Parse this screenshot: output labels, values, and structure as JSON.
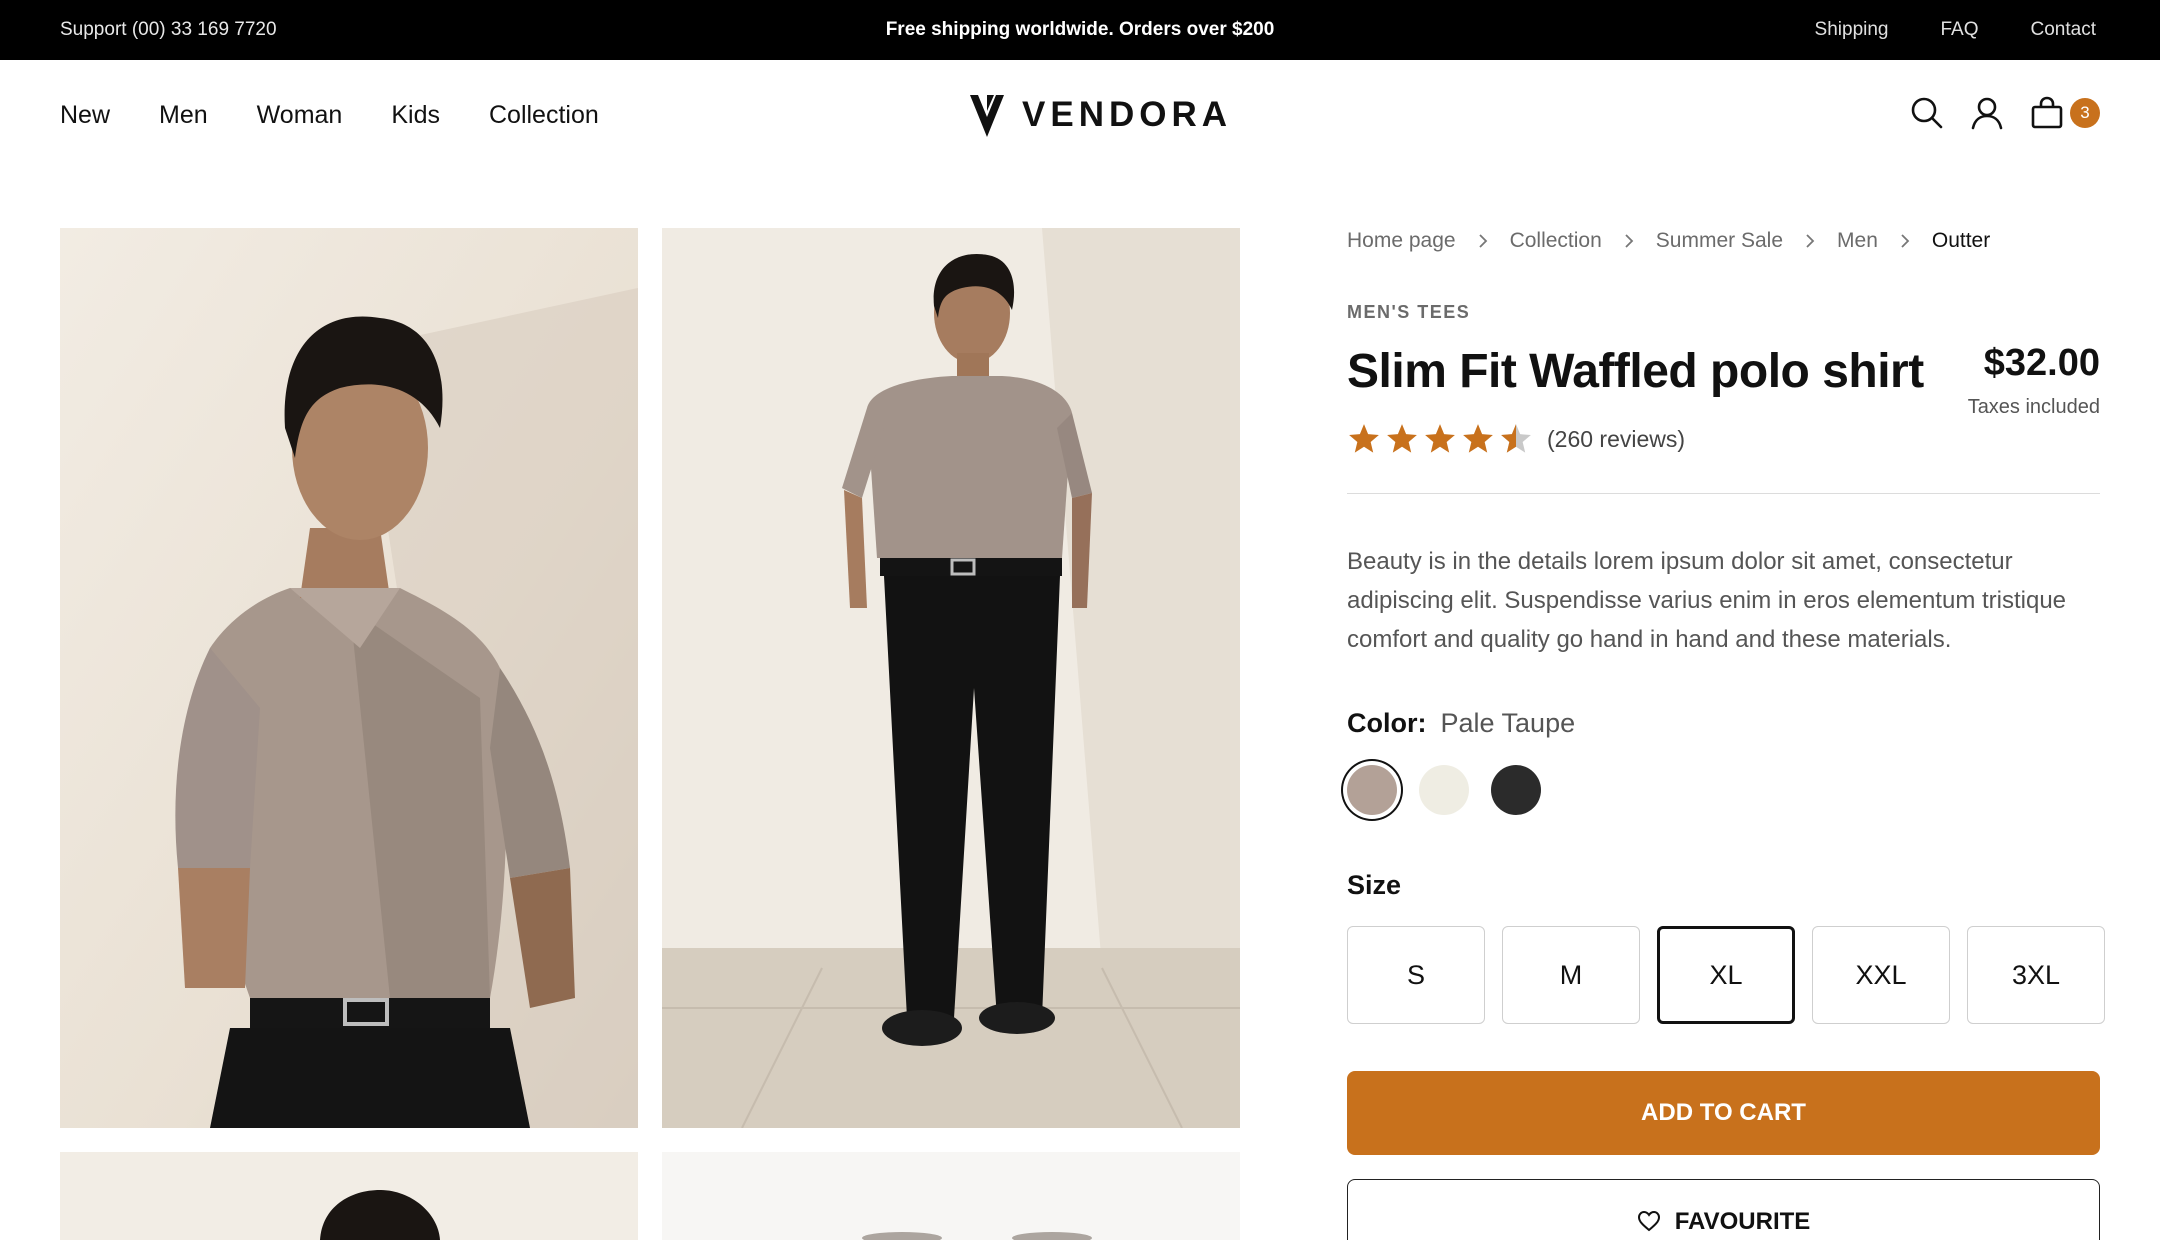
{
  "topbar": {
    "support": "Support (00) 33 169 7720",
    "promo": "Free shipping worldwide. Orders over $200",
    "links": [
      "Shipping",
      "FAQ",
      "Contact"
    ]
  },
  "nav": {
    "items": [
      "New",
      "Men",
      "Woman",
      "Kids",
      "Collection"
    ]
  },
  "brand": {
    "name": "VENDORA"
  },
  "cart": {
    "count": "3"
  },
  "breadcrumb": [
    "Home page",
    "Collection",
    "Summer Sale",
    "Men",
    "Outter"
  ],
  "product": {
    "category": "MEN'S TEES",
    "title": "Slim Fit Waffled polo shirt",
    "price": "$32.00",
    "tax_note": "Taxes included",
    "rating": 4.5,
    "reviews": "(260 reviews)",
    "description": "Beauty is in the details lorem ipsum dolor sit amet, consectetur adipiscing elit. Suspendisse varius enim in eros elementum tristique comfort and quality go hand in hand and these materials.",
    "color_label": "Color:",
    "color_value": "Pale Taupe",
    "colors": [
      "#b3a197",
      "#efede3",
      "#2b2b2b"
    ],
    "size_label": "Size",
    "sizes": [
      "S",
      "M",
      "XL",
      "XXL",
      "3XL"
    ],
    "selected_size": "XL",
    "add_to_cart": "ADD TO CART",
    "favourite": "FAVOURITE"
  },
  "colors": {
    "accent": "#c8711c",
    "topbar_bg": "#000000",
    "star": "#c8711c"
  }
}
